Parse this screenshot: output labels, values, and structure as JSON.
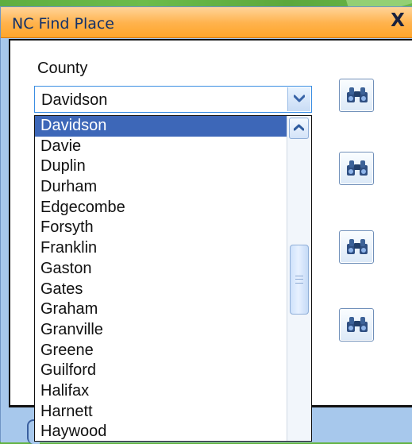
{
  "window": {
    "title": "NC Find Place",
    "close_label": "X"
  },
  "form": {
    "county_label": "County",
    "county_selected": "Davidson"
  },
  "dropdown": {
    "items": [
      "Davidson",
      "Davie",
      "Duplin",
      "Durham",
      "Edgecombe",
      "Forsyth",
      "Franklin",
      "Gaston",
      "Gates",
      "Graham",
      "Granville",
      "Greene",
      "Guilford",
      "Halifax",
      "Harnett",
      "Haywood"
    ],
    "selected_index": 0
  },
  "icons": {
    "close": "close-icon",
    "dropdown": "chevron-down-icon",
    "scroll_up": "chevron-up-icon",
    "find": "binoculars-icon"
  },
  "colors": {
    "titlebar": "#ffb34d",
    "selection": "#3d67b8",
    "background": "#63b342"
  }
}
